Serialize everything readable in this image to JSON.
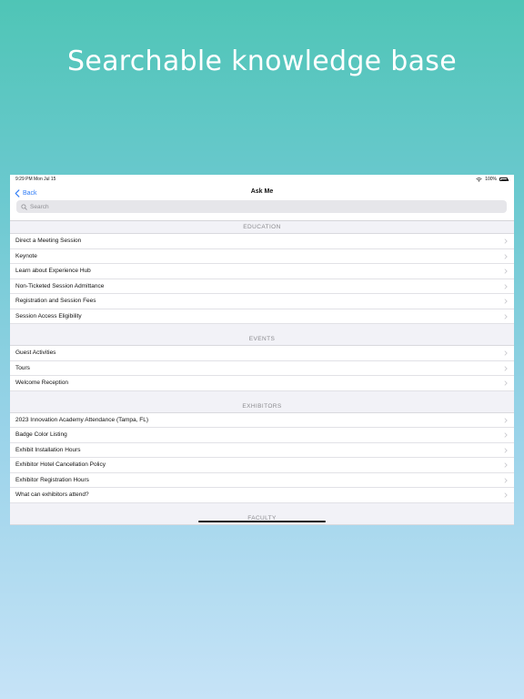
{
  "headline": "Searchable knowledge base",
  "status_bar": {
    "time": "9:29 PM   Mon Jul 15",
    "battery": "100%"
  },
  "nav": {
    "back_label": "Back",
    "title": "Ask Me"
  },
  "search": {
    "placeholder": "Search"
  },
  "sections": [
    {
      "title": "EDUCATION",
      "items": [
        "Direct a  Meeting Session",
        "Keynote",
        "Learn about Experience Hub",
        "Non-Ticketed Session Admittance",
        "Registration and Session Fees",
        "Session Access Eligibility"
      ]
    },
    {
      "title": "EVENTS",
      "items": [
        "Guest Activities",
        "Tours",
        "Welcome Reception"
      ]
    },
    {
      "title": "EXHIBITORS",
      "items": [
        "2023 Innovation Academy Attendance (Tampa, FL)",
        "Badge Color Listing",
        "Exhibit Installation Hours",
        "Exhibitor Hotel Cancellation Policy",
        "Exhibitor Registration Hours",
        "What can exhibitors attend?"
      ]
    },
    {
      "title": "FACULTY",
      "items": []
    }
  ],
  "colors": {
    "accent": "#2f7cf6"
  }
}
